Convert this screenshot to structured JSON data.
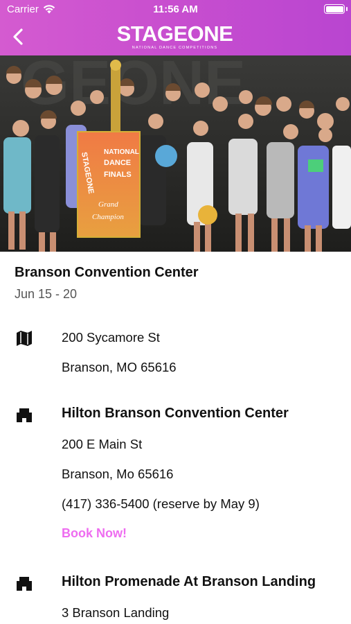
{
  "status_bar": {
    "carrier": "Carrier",
    "time": "11:56 AM"
  },
  "header": {
    "logo_text": "STAGEONE",
    "logo_subtitle": "NATIONAL DANCE COMPETITIONS",
    "colors": {
      "gradient_start": "#d45bd0",
      "gradient_end": "#b945d0"
    }
  },
  "hero": {
    "banner_text": [
      "STAGEONE",
      "NATIONAL",
      "DANCE",
      "FINALS",
      "Grand",
      "Champion"
    ]
  },
  "venue": {
    "name": "Branson Convention Center",
    "dates": "Jun 15 - 20",
    "address_icon": "map-icon",
    "address_line1": "200 Sycamore St",
    "address_line2": "Branson, MO 65616"
  },
  "hotels": [
    {
      "icon": "building-icon",
      "name": "Hilton Branson Convention Center",
      "address_line1": "200 E Main St",
      "address_line2": "Branson, Mo 65616",
      "phone": "(417) 336-5400 (reserve by May 9)",
      "book_label": "Book Now!"
    },
    {
      "icon": "building-icon",
      "name": "Hilton Promenade At Branson Landing",
      "address_line1": "3 Branson Landing"
    }
  ],
  "accent_color": "#ee6cf0"
}
